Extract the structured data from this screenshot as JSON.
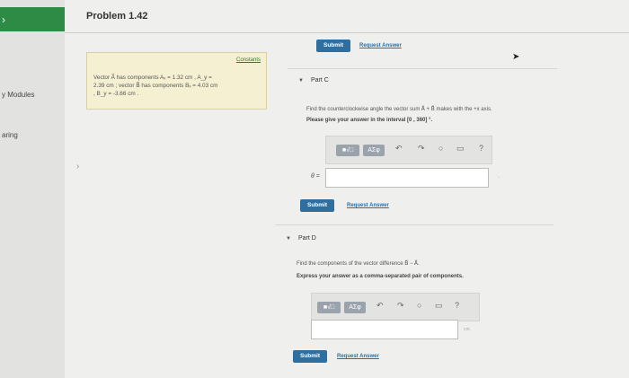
{
  "title": "Problem 1.42",
  "sidebar": {
    "arrow": "›",
    "items": [
      "y Modules",
      "aring"
    ]
  },
  "left_chevron": "›",
  "constants": {
    "header": "Constants",
    "lines": [
      "Vector A⃗ has components Aₓ = 1.32 cm , A_y =",
      "2.39 cm ; vector B⃗ has components Bₓ = 4.03 cm",
      ", B_y = -3.66 cm ."
    ]
  },
  "top_submit": {
    "submit": "Submit",
    "request": "Request Answer"
  },
  "partC": {
    "label": "Part C",
    "question": "Find the counterclockwise angle the vector sum A⃗ + B⃗ makes with the +x axis.",
    "instruction": "Please give your answer in the interval [0 , 360] °.",
    "var_label": "θ =",
    "submit": "Submit",
    "request": "Request Answer"
  },
  "partD": {
    "label": "Part D",
    "question": "Find the components of the vector difference B⃗ − A⃗.",
    "instruction": "Express your answer as a comma-separated pair of components.",
    "unit_hint": "cm",
    "submit": "Submit",
    "request": "Request Answer"
  },
  "toolbar": {
    "matrix_icon": "■√□",
    "symbol_icon": "ΑΣφ",
    "undo": "↶",
    "redo": "↷",
    "reset": "○",
    "keyboard": "▭",
    "help": "?"
  },
  "cursor": "➤"
}
